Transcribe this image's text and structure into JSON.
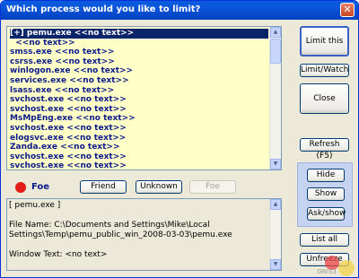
{
  "window": {
    "title": "Which process would you like to limit?",
    "close_glyph": "✕"
  },
  "process_list": {
    "items": [
      {
        "label": "[+] pemu.exe <<no text>>",
        "selected": true
      },
      {
        "label": "  <<no text>>"
      },
      {
        "label": "smss.exe <<no text>>"
      },
      {
        "label": "csrss.exe <<no text>>"
      },
      {
        "label": "winlogon.exe <<no text>>"
      },
      {
        "label": "services.exe <<no text>>"
      },
      {
        "label": "lsass.exe <<no text>>"
      },
      {
        "label": "svchost.exe <<no text>>"
      },
      {
        "label": "svchost.exe <<no text>>"
      },
      {
        "label": "MsMpEng.exe <<no text>>"
      },
      {
        "label": "svchost.exe <<no text>>"
      },
      {
        "label": "elogsvc.exe <<no text>>"
      },
      {
        "label": "Zanda.exe <<no text>>"
      },
      {
        "label": "svchost.exe <<no text>>"
      },
      {
        "label": "svchost.exe <<no text>>"
      }
    ]
  },
  "status": {
    "label": "Foe",
    "color": "#e41b17"
  },
  "classify": {
    "friend": "Friend",
    "unknown": "Unknown",
    "foe": "Foe"
  },
  "info": {
    "line1": "[ pemu.exe ]",
    "line2": "File Name: C:\\Documents and Settings\\Mike\\Local",
    "line3": "Settings\\Temp\\pemu_public_win_2008-03-03\\pemu.exe",
    "line4": "Window Text: <no text>"
  },
  "actions": {
    "limit_this": "Limit this",
    "limit_watch": "Limit/Watch",
    "close": "Close",
    "refresh": "Refresh (F5)",
    "hide": "Hide",
    "show": "Show",
    "ask_show": "Ask/show",
    "list_all": "List all",
    "unfreeze": "Unfreeze"
  },
  "watermark": "GNIS3"
}
